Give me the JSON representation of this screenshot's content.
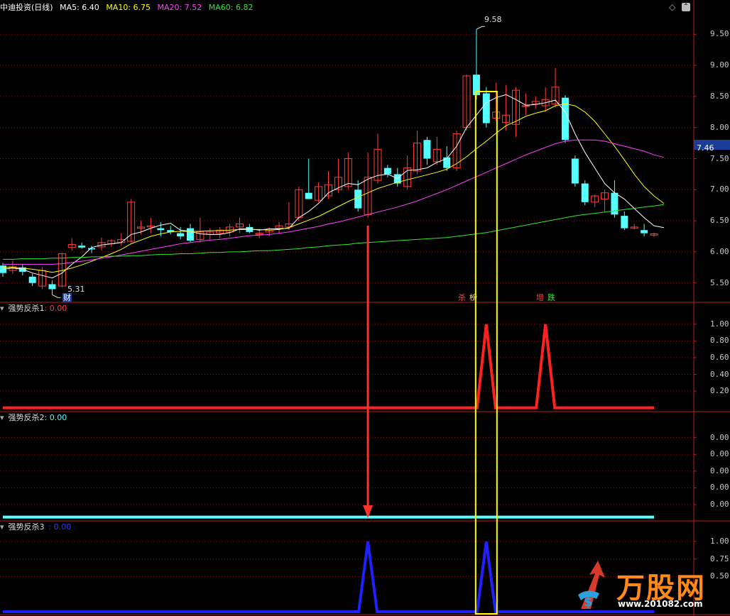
{
  "header": {
    "title": "中迪投资(日线)",
    "ma5": "MA5: 6.40",
    "ma10": "MA10: 6.75",
    "ma20": "MA20: 7.52",
    "ma60": "MA60: 6.82"
  },
  "price_panel": {
    "high_label": "9.58",
    "low_label": "5.31",
    "current_price": "7.46",
    "yticks": [
      "9.50",
      "9.00",
      "8.50",
      "8.00",
      "7.50",
      "7.00",
      "6.50",
      "6.00",
      "5.50"
    ],
    "tags": {
      "cai": "财",
      "sha": "杀",
      "bang": "榜",
      "zeng": "增",
      "die": "跌"
    }
  },
  "ind1": {
    "name": "强势反杀1",
    "value": ": 0.00",
    "yticks": [
      "1.00",
      "0.80",
      "0.60",
      "0.40",
      "0.20"
    ]
  },
  "ind2": {
    "name": "强势反杀2",
    "value": ": 0.00",
    "yticks": [
      "0.00",
      "0.00",
      "0.00",
      "0.00",
      "0.00"
    ]
  },
  "ind3": {
    "name": "强势反杀3",
    "value": ": 0.00",
    "yticks": [
      "1.00",
      "0.75",
      "0.50"
    ]
  },
  "watermark": {
    "text": "万股网",
    "url": "www.201082.com"
  },
  "colors": {
    "up": "#ff3c3c",
    "down": "#54ffff",
    "ma5": "#ffffff",
    "ma10": "#ffff00",
    "ma20": "#ff40ff",
    "ma60": "#30e830",
    "highlight": "#ffff00"
  },
  "chart_data": [
    {
      "type": "candlestick",
      "title": "中迪投资(日线)",
      "ylim": [
        5.2,
        9.8
      ],
      "candles": [
        {
          "o": 5.78,
          "h": 5.82,
          "l": 5.6,
          "c": 5.66
        },
        {
          "o": 5.7,
          "h": 5.86,
          "l": 5.65,
          "c": 5.76
        },
        {
          "o": 5.75,
          "h": 5.8,
          "l": 5.62,
          "c": 5.68
        },
        {
          "o": 5.6,
          "h": 5.65,
          "l": 5.45,
          "c": 5.5
        },
        {
          "o": 5.45,
          "h": 5.76,
          "l": 5.4,
          "c": 5.7
        },
        {
          "o": 5.48,
          "h": 5.54,
          "l": 5.31,
          "c": 5.4
        },
        {
          "o": 5.45,
          "h": 5.98,
          "l": 5.43,
          "c": 5.97
        },
        {
          "o": 6.07,
          "h": 6.22,
          "l": 6.02,
          "c": 6.12
        },
        {
          "o": 6.1,
          "h": 6.15,
          "l": 6.05,
          "c": 6.07
        },
        {
          "o": 6.06,
          "h": 6.1,
          "l": 5.98,
          "c": 6.04
        },
        {
          "o": 6.08,
          "h": 6.23,
          "l": 6.02,
          "c": 6.15
        },
        {
          "o": 6.13,
          "h": 6.2,
          "l": 6.08,
          "c": 6.18
        },
        {
          "o": 6.15,
          "h": 6.3,
          "l": 6.1,
          "c": 6.2
        },
        {
          "o": 6.17,
          "h": 6.85,
          "l": 6.15,
          "c": 6.8
        },
        {
          "o": 6.38,
          "h": 6.5,
          "l": 6.28,
          "c": 6.4
        },
        {
          "o": 6.4,
          "h": 6.55,
          "l": 6.3,
          "c": 6.42
        },
        {
          "o": 6.38,
          "h": 6.48,
          "l": 6.25,
          "c": 6.35
        },
        {
          "o": 6.35,
          "h": 6.42,
          "l": 6.28,
          "c": 6.32
        },
        {
          "o": 6.3,
          "h": 6.4,
          "l": 6.2,
          "c": 6.25
        },
        {
          "o": 6.38,
          "h": 6.45,
          "l": 6.15,
          "c": 6.18
        },
        {
          "o": 6.2,
          "h": 6.55,
          "l": 6.15,
          "c": 6.32
        },
        {
          "o": 6.28,
          "h": 6.38,
          "l": 6.2,
          "c": 6.32
        },
        {
          "o": 6.3,
          "h": 6.4,
          "l": 6.22,
          "c": 6.35
        },
        {
          "o": 6.32,
          "h": 6.45,
          "l": 6.25,
          "c": 6.4
        },
        {
          "o": 6.4,
          "h": 6.55,
          "l": 6.3,
          "c": 6.45
        },
        {
          "o": 6.4,
          "h": 6.45,
          "l": 6.3,
          "c": 6.32
        },
        {
          "o": 6.28,
          "h": 6.36,
          "l": 6.22,
          "c": 6.3
        },
        {
          "o": 6.32,
          "h": 6.4,
          "l": 6.25,
          "c": 6.35
        },
        {
          "o": 6.38,
          "h": 6.48,
          "l": 6.3,
          "c": 6.42
        },
        {
          "o": 6.4,
          "h": 6.8,
          "l": 6.35,
          "c": 6.45
        },
        {
          "o": 6.55,
          "h": 7.05,
          "l": 6.5,
          "c": 7.0
        },
        {
          "o": 6.95,
          "h": 7.5,
          "l": 6.85,
          "c": 6.85
        },
        {
          "o": 6.83,
          "h": 7.12,
          "l": 6.8,
          "c": 7.05
        },
        {
          "o": 6.9,
          "h": 7.3,
          "l": 6.85,
          "c": 7.08
        },
        {
          "o": 7.0,
          "h": 7.5,
          "l": 6.95,
          "c": 7.2
        },
        {
          "o": 7.05,
          "h": 7.6,
          "l": 7.0,
          "c": 7.5
        },
        {
          "o": 7.0,
          "h": 7.15,
          "l": 6.65,
          "c": 6.7
        },
        {
          "o": 6.6,
          "h": 7.6,
          "l": 6.55,
          "c": 7.2
        },
        {
          "o": 7.15,
          "h": 7.9,
          "l": 7.1,
          "c": 7.65
        },
        {
          "o": 7.35,
          "h": 7.4,
          "l": 7.2,
          "c": 7.25
        },
        {
          "o": 7.25,
          "h": 7.35,
          "l": 7.05,
          "c": 7.1
        },
        {
          "o": 7.05,
          "h": 7.55,
          "l": 7.0,
          "c": 7.35
        },
        {
          "o": 7.3,
          "h": 7.95,
          "l": 7.25,
          "c": 7.75
        },
        {
          "o": 7.8,
          "h": 7.85,
          "l": 7.4,
          "c": 7.5
        },
        {
          "o": 7.45,
          "h": 7.85,
          "l": 7.4,
          "c": 7.65
        },
        {
          "o": 7.52,
          "h": 7.7,
          "l": 7.3,
          "c": 7.35
        },
        {
          "o": 7.35,
          "h": 7.95,
          "l": 7.3,
          "c": 7.9
        },
        {
          "o": 8.0,
          "h": 8.85,
          "l": 7.95,
          "c": 8.83
        },
        {
          "o": 8.85,
          "h": 9.58,
          "l": 8.45,
          "c": 8.52
        },
        {
          "o": 8.55,
          "h": 8.65,
          "l": 8.0,
          "c": 8.07
        },
        {
          "o": 8.15,
          "h": 8.72,
          "l": 8.1,
          "c": 8.25
        },
        {
          "o": 8.08,
          "h": 8.68,
          "l": 7.95,
          "c": 8.2
        },
        {
          "o": 8.05,
          "h": 8.65,
          "l": 7.85,
          "c": 8.6
        },
        {
          "o": 8.35,
          "h": 8.55,
          "l": 8.2,
          "c": 8.35
        },
        {
          "o": 8.38,
          "h": 8.5,
          "l": 8.3,
          "c": 8.42
        },
        {
          "o": 8.35,
          "h": 8.65,
          "l": 8.25,
          "c": 8.45
        },
        {
          "o": 8.38,
          "h": 8.96,
          "l": 8.32,
          "c": 8.65
        },
        {
          "o": 8.48,
          "h": 8.52,
          "l": 7.75,
          "c": 7.8
        },
        {
          "o": 7.5,
          "h": 7.55,
          "l": 7.05,
          "c": 7.1
        },
        {
          "o": 7.1,
          "h": 7.15,
          "l": 6.75,
          "c": 6.8
        },
        {
          "o": 6.8,
          "h": 6.92,
          "l": 6.72,
          "c": 6.9
        },
        {
          "o": 6.85,
          "h": 7.0,
          "l": 6.65,
          "c": 6.95
        },
        {
          "o": 6.95,
          "h": 7.15,
          "l": 6.55,
          "c": 6.6
        },
        {
          "o": 6.58,
          "h": 6.65,
          "l": 6.35,
          "c": 6.38
        },
        {
          "o": 6.38,
          "h": 6.45,
          "l": 6.36,
          "c": 6.4
        },
        {
          "o": 6.35,
          "h": 6.45,
          "l": 6.25,
          "c": 6.3
        },
        {
          "o": 6.27,
          "h": 6.31,
          "l": 6.24,
          "c": 6.29
        }
      ],
      "ma_series": [
        {
          "name": "MA5",
          "values": [
            5.72,
            5.74,
            5.72,
            5.66,
            5.62,
            5.58,
            5.66,
            5.8,
            5.92,
            6.07,
            6.11,
            6.13,
            6.15,
            6.28,
            6.32,
            6.38,
            6.43,
            6.46,
            6.35,
            6.33,
            6.29,
            6.28,
            6.28,
            6.31,
            6.37,
            6.37,
            6.35,
            6.37,
            6.37,
            6.38,
            6.55,
            6.65,
            6.78,
            6.95,
            7.03,
            7.1,
            7.08,
            7.17,
            7.23,
            7.25,
            7.18,
            7.31,
            7.32,
            7.35,
            7.44,
            7.5,
            7.7,
            8.0,
            8.2,
            8.4,
            8.48,
            8.53,
            8.45,
            8.36,
            8.37,
            8.4,
            8.44,
            8.25,
            7.9,
            7.6,
            7.35,
            7.1,
            6.95,
            6.85,
            6.7,
            6.55,
            6.42,
            6.39
          ]
        },
        {
          "name": "MA10",
          "values": [
            5.75,
            5.75,
            5.74,
            5.72,
            5.7,
            5.67,
            5.7,
            5.74,
            5.79,
            5.85,
            5.91,
            5.97,
            6.04,
            6.13,
            6.19,
            6.25,
            6.29,
            6.32,
            6.33,
            6.33,
            6.33,
            6.34,
            6.34,
            6.35,
            6.36,
            6.36,
            6.36,
            6.35,
            6.36,
            6.39,
            6.45,
            6.51,
            6.57,
            6.65,
            6.73,
            6.81,
            6.88,
            6.95,
            7.02,
            7.07,
            7.12,
            7.16,
            7.2,
            7.24,
            7.28,
            7.33,
            7.42,
            7.53,
            7.66,
            7.78,
            7.91,
            8.03,
            8.1,
            8.18,
            8.23,
            8.27,
            8.35,
            8.38,
            8.35,
            8.25,
            8.1,
            7.9,
            7.7,
            7.48,
            7.25,
            7.05,
            6.9,
            6.78
          ]
        },
        {
          "name": "MA20",
          "values": [
            5.8,
            5.8,
            5.8,
            5.8,
            5.8,
            5.8,
            5.81,
            5.83,
            5.85,
            5.87,
            5.9,
            5.92,
            5.95,
            5.98,
            6.01,
            6.04,
            6.07,
            6.1,
            6.13,
            6.15,
            6.17,
            6.19,
            6.2,
            6.22,
            6.24,
            6.26,
            6.27,
            6.28,
            6.3,
            6.32,
            6.35,
            6.38,
            6.41,
            6.45,
            6.48,
            6.52,
            6.56,
            6.6,
            6.64,
            6.68,
            6.72,
            6.77,
            6.82,
            6.88,
            6.94,
            7.0,
            7.07,
            7.14,
            7.21,
            7.28,
            7.35,
            7.42,
            7.49,
            7.56,
            7.62,
            7.68,
            7.74,
            7.78,
            7.8,
            7.8,
            7.8,
            7.78,
            7.74,
            7.7,
            7.66,
            7.62,
            7.56,
            7.52
          ]
        },
        {
          "name": "MA60",
          "values": [
            5.88,
            5.88,
            5.89,
            5.89,
            5.89,
            5.9,
            5.9,
            5.91,
            5.91,
            5.92,
            5.92,
            5.93,
            5.93,
            5.94,
            5.94,
            5.95,
            5.96,
            5.96,
            5.97,
            5.97,
            5.98,
            5.99,
            5.99,
            6.0,
            6.0,
            6.01,
            6.02,
            6.02,
            6.03,
            6.04,
            6.05,
            6.07,
            6.08,
            6.1,
            6.11,
            6.12,
            6.14,
            6.15,
            6.16,
            6.17,
            6.18,
            6.19,
            6.2,
            6.21,
            6.22,
            6.23,
            6.25,
            6.27,
            6.29,
            6.31,
            6.34,
            6.37,
            6.4,
            6.43,
            6.46,
            6.49,
            6.52,
            6.55,
            6.58,
            6.6,
            6.62,
            6.64,
            6.66,
            6.68,
            6.7,
            6.72,
            6.74,
            6.76
          ]
        }
      ]
    },
    {
      "type": "line",
      "title": "强势反杀1",
      "ylim": [
        -0.02,
        1.1
      ],
      "signals": [
        {
          "index": 49,
          "value": 1.0
        },
        {
          "index": 55,
          "value": 1.0
        }
      ]
    },
    {
      "type": "line",
      "title": "强势反杀2",
      "ylim": [
        -0.02,
        1.1
      ],
      "signals": []
    },
    {
      "type": "line",
      "title": "强势反杀3",
      "ylim": [
        -0.02,
        1.1
      ],
      "signals": [
        {
          "index": 37,
          "value": 1.0
        },
        {
          "index": 49,
          "value": 1.0
        }
      ]
    }
  ]
}
